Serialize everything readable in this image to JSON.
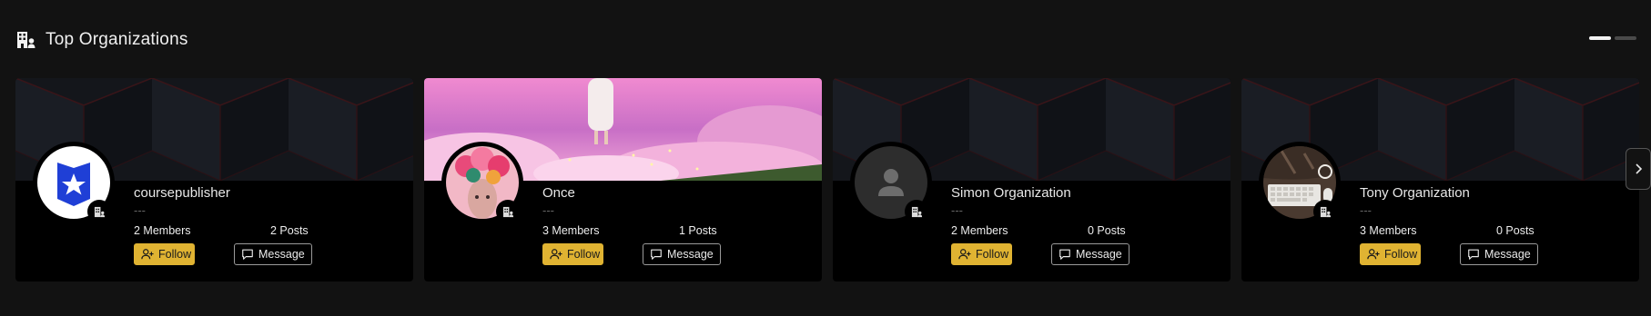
{
  "section": {
    "title": "Top Organizations",
    "icon": "building-user-icon"
  },
  "pager": {
    "pages": 2,
    "active_index": 0
  },
  "organizations": [
    {
      "name": "coursepublisher",
      "description": "---",
      "members": "2 Members",
      "posts": "2 Posts",
      "avatar": "blue-shield-star-logo",
      "banner": "dark-geometric-pattern",
      "follow_label": "Follow",
      "message_label": "Message"
    },
    {
      "name": "Once",
      "description": "---",
      "members": "3 Members",
      "posts": "1 Posts",
      "avatar": "floral-portrait-photo",
      "banner": "pink-clouds-photo",
      "follow_label": "Follow",
      "message_label": "Message"
    },
    {
      "name": "Simon Organization",
      "description": "---",
      "members": "2 Members",
      "posts": "0 Posts",
      "avatar": "default-user-icon",
      "banner": "dark-geometric-pattern",
      "follow_label": "Follow",
      "message_label": "Message"
    },
    {
      "name": "Tony Organization",
      "description": "---",
      "members": "3 Members",
      "posts": "0 Posts",
      "avatar": "keyboard-desk-photo",
      "banner": "dark-geometric-pattern",
      "follow_label": "Follow",
      "message_label": "Message"
    }
  ],
  "colors": {
    "background": "#121212",
    "card": "#000000",
    "accent": "#e0b332"
  },
  "next_button_icon": "chevron-right-icon"
}
